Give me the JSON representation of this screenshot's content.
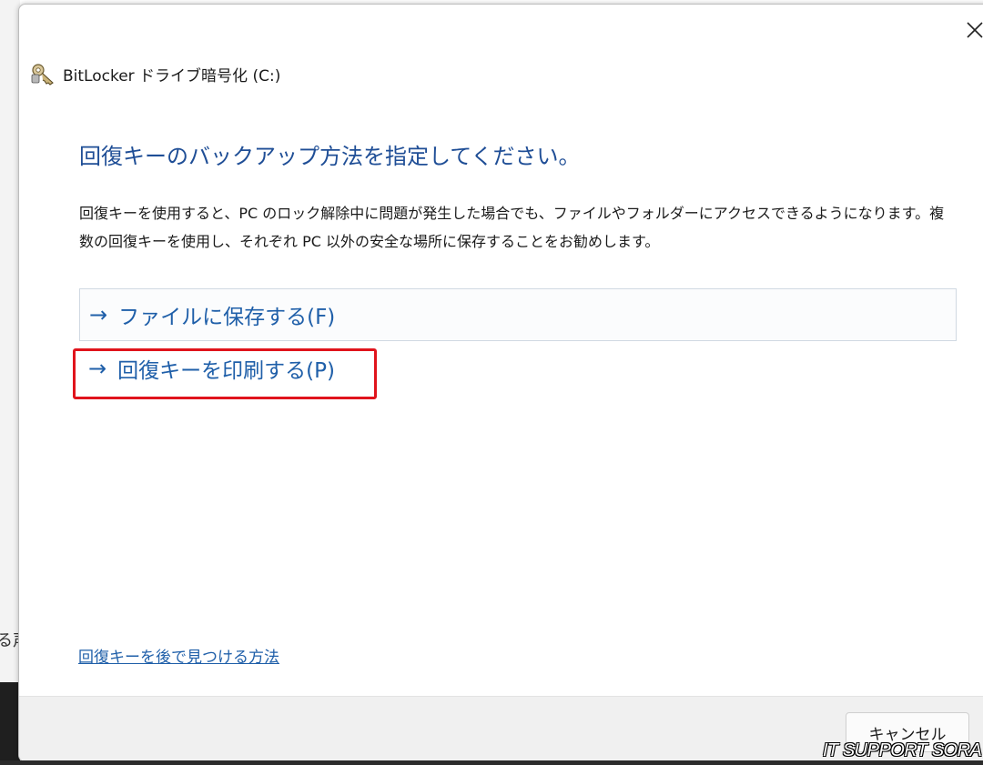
{
  "window": {
    "title": "BitLocker ドライブ暗号化 (C:)",
    "close_icon": "close-icon",
    "app_icon": "bitlocker-key-icon"
  },
  "main": {
    "heading": "回復キーのバックアップ方法を指定してください。",
    "description": "回復キーを使用すると、PC のロック解除中に問題が発生した場合でも、ファイルやフォルダーにアクセスできるようになります。複数の回復キーを使用し、それぞれ PC 以外の安全な場所に保存することをお勧めします。",
    "options": [
      {
        "arrow": "→",
        "label": "ファイルに保存する(F)"
      },
      {
        "arrow": "→",
        "label": "回復キーを印刷する(P)"
      }
    ],
    "help_link": "回復キーを後で見つける方法"
  },
  "footer": {
    "cancel_label": "キャンセル"
  },
  "background": {
    "left_text": "る声"
  },
  "watermark": "IT SUPPORT SORA",
  "colors": {
    "heading": "#1f4e96",
    "link": "#1f5fa9",
    "highlight": "#e0141c"
  }
}
